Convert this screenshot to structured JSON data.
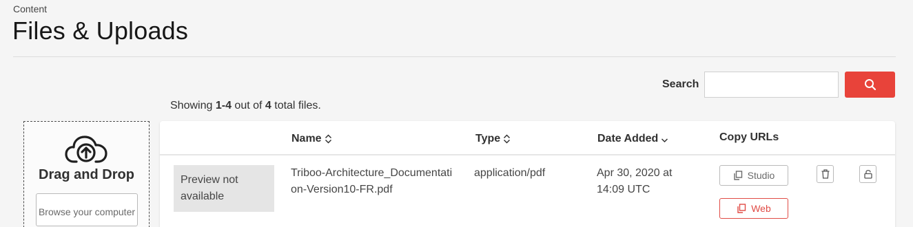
{
  "header": {
    "eyebrow": "Content",
    "title": "Files & Uploads"
  },
  "search": {
    "label": "Search",
    "value": "",
    "placeholder": ""
  },
  "summary": {
    "prefix": "Showing ",
    "range_start": "1",
    "dash": "-",
    "range_end": "4",
    "mid": " out of ",
    "total": "4",
    "suffix": " total files."
  },
  "upload": {
    "title": "Drag and Drop",
    "browse_label": "Browse your computer"
  },
  "table": {
    "columns": {
      "name": "Name",
      "type": "Type",
      "date_added": "Date Added",
      "copy_urls": "Copy URLs"
    },
    "rows": [
      {
        "preview": "Preview not available",
        "name": "Triboo-Architecture_Documentation-Version10-FR.pdf",
        "type": "application/pdf",
        "date_added": "Apr 30, 2020 at 14:09 UTC",
        "studio_label": "Studio",
        "web_label": "Web"
      }
    ]
  },
  "colors": {
    "accent": "#e8433a",
    "web_button": "#e04a44",
    "text": "#313131",
    "background": "#f5f5f5"
  },
  "icons": {
    "search": "search-icon",
    "upload": "cloud-upload-icon",
    "copy": "copy-icon",
    "delete": "trash-icon",
    "lock": "unlock-icon",
    "sort": "sort-icon",
    "sort_desc": "sort-desc-icon"
  }
}
